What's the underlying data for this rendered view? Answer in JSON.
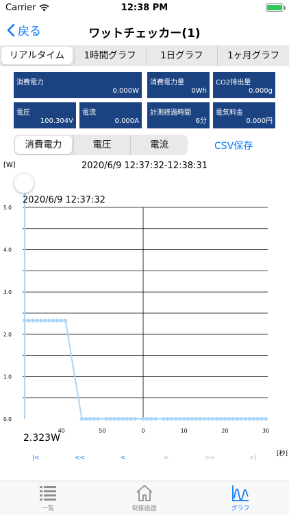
{
  "status_bar": {
    "carrier": "Carrier",
    "time": "12:38 PM"
  },
  "nav": {
    "back_label": "戻る",
    "title": "ワットチェッカー(1)"
  },
  "top_tabs": [
    {
      "label": "リアルタイム",
      "active": true
    },
    {
      "label": "1時間グラフ",
      "active": false
    },
    {
      "label": "1日グラフ",
      "active": false
    },
    {
      "label": "1ヶ月グラフ",
      "active": false
    }
  ],
  "info": {
    "power": {
      "label": "消費電力",
      "value": "0.000W"
    },
    "energy": {
      "label": "消費電力量",
      "value": "0Wh"
    },
    "co2": {
      "label": "CO2排出量",
      "value": "0.000g"
    },
    "voltage": {
      "label": "電圧",
      "value": "100.304V"
    },
    "current": {
      "label": "電流",
      "value": "0.000A"
    },
    "elapsed": {
      "label": "計測経過時間",
      "value": "6分"
    },
    "cost": {
      "label": "電気料金",
      "value": "0.000円"
    }
  },
  "sub_tabs": [
    {
      "label": "消費電力",
      "active": true
    },
    {
      "label": "電圧",
      "active": false
    },
    {
      "label": "電流",
      "active": false
    }
  ],
  "csv_label": "CSV保存",
  "chart": {
    "unit_label": "[W]",
    "range_title": "2020/6/9 12:37:32-12:38:31",
    "cursor_time": "2020/6/9 12:37:32",
    "cursor_value": "2.323W",
    "x_unit_label": "[秒]"
  },
  "chart_data": {
    "type": "line",
    "ylim": [
      0,
      5
    ],
    "y_ticks": [
      "0.0",
      "1.0",
      "2.0",
      "3.0",
      "4.0",
      "5.0"
    ],
    "x_tick_labels": [
      {
        "x": 40,
        "label": "40"
      },
      {
        "x": 50,
        "label": "50"
      },
      {
        "x": 60,
        "label": "0"
      },
      {
        "x": 70,
        "label": "10"
      },
      {
        "x": 80,
        "label": "20"
      },
      {
        "x": 90,
        "label": "30"
      }
    ],
    "xlim": [
      30.5,
      90.5
    ],
    "series": [
      {
        "color": "#a9d5f7",
        "x": [
          31,
          32,
          33,
          34,
          35,
          36,
          37,
          38,
          39,
          40,
          41,
          45,
          46,
          47,
          48,
          49,
          51,
          52,
          53,
          54,
          55,
          56,
          57,
          58,
          60,
          61,
          62,
          63,
          65,
          66,
          67,
          68,
          69,
          70,
          71,
          72,
          73,
          74,
          75,
          76,
          77,
          78,
          79,
          80,
          81,
          82,
          83,
          84,
          85,
          86,
          87,
          88,
          89,
          90
        ],
        "y": [
          2.323,
          2.323,
          2.323,
          2.323,
          2.323,
          2.323,
          2.323,
          2.323,
          2.323,
          2.323,
          2.323,
          0,
          0,
          0,
          0,
          0,
          0,
          0,
          0,
          0,
          0,
          0,
          0,
          0,
          0,
          0,
          0,
          0,
          0,
          0,
          0,
          0,
          0,
          0,
          0,
          0,
          0,
          0,
          0,
          0,
          0,
          0,
          0,
          0,
          0,
          0,
          0,
          0,
          0,
          0,
          0,
          0,
          0,
          0
        ]
      }
    ],
    "grid": true
  },
  "pager": {
    "first": "|<",
    "prev_fast": "<<",
    "prev": "<",
    "next": ">",
    "next_fast": ">>",
    "last": ">|"
  },
  "tab_bar": {
    "list_label": "一覧",
    "control_label": "制御画面",
    "graph_label": "グラフ"
  },
  "colors": {
    "accent": "#0a7aff",
    "tile": "#1c4381",
    "line": "#a9d5f7"
  }
}
